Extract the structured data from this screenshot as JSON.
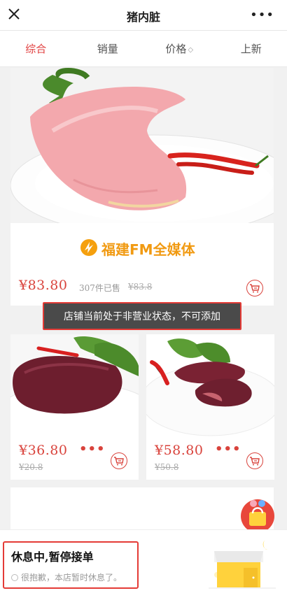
{
  "header": {
    "title": "猪内脏",
    "close_icon": "close-icon",
    "more_icon": "more-icon",
    "more_glyph": "•••"
  },
  "tabs": [
    {
      "label": "综合",
      "active": true
    },
    {
      "label": "销量",
      "active": false
    },
    {
      "label": "价格",
      "active": false,
      "sort_glyph": "◇"
    },
    {
      "label": "上新",
      "active": false
    }
  ],
  "products": {
    "featured": {
      "price": "¥83.80",
      "sold": "307件已售",
      "old_price": "¥83.8",
      "logo_text": "福建FM全媒体"
    },
    "left": {
      "price": "¥36.80",
      "old_price": "¥20.8",
      "more": "•••"
    },
    "right": {
      "price": "¥58.80",
      "old_price": "¥50.8",
      "more": "•••"
    }
  },
  "toast": {
    "text": "店铺当前处于非营业状态，不可添加"
  },
  "closed": {
    "title": "休息中,暂停接单",
    "subtitle": "很抱歉，本店暂时休息了。"
  },
  "colors": {
    "accent": "#d9433c",
    "highlight_border": "#e43b36"
  }
}
